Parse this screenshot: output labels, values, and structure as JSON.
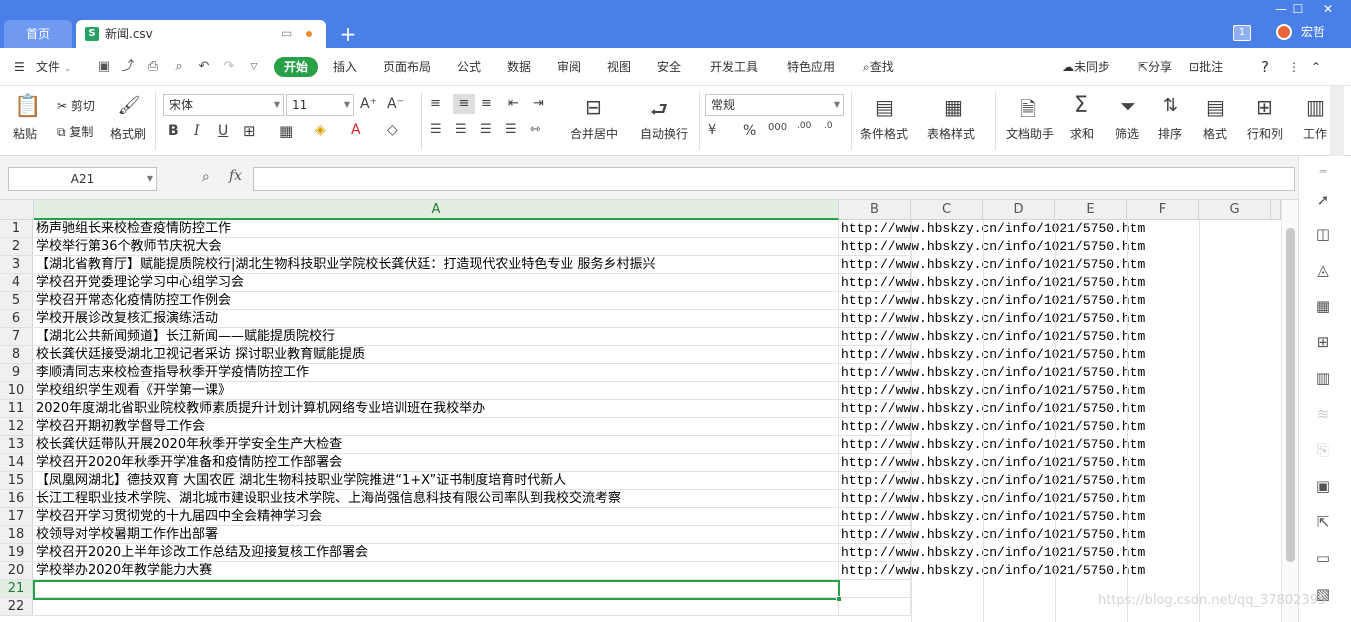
{
  "tabs": {
    "home": "首页",
    "file": "新闻.csv",
    "plus": "+"
  },
  "window": {
    "badge": "1",
    "user": "宏哲",
    "min": "—",
    "max": "☐",
    "close": "✕"
  },
  "menu": {
    "file": "文件",
    "start": "开始",
    "items": [
      "插入",
      "页面布局",
      "公式",
      "数据",
      "审阅",
      "视图",
      "安全",
      "开发工具",
      "特色应用"
    ],
    "search": "查找",
    "sync": "未同步",
    "share": "分享",
    "comment": "批注",
    "help": "?"
  },
  "ribbon": {
    "paste": "粘贴",
    "cut": "剪切",
    "copy": "复制",
    "format_painter": "格式刷",
    "font": "宋体",
    "size": "11",
    "merge": "合并居中",
    "wrap": "自动换行",
    "numfmt": "常规",
    "cond_format": "条件格式",
    "table_style": "表格样式",
    "doc_helper": "文档助手",
    "sum": "求和",
    "filter": "筛选",
    "sort": "排序",
    "format": "格式",
    "rowcol": "行和列",
    "worksheet": "工作"
  },
  "formula": {
    "namebox": "A21",
    "fx": "fx",
    "value": ""
  },
  "columns": [
    "A",
    "B",
    "C",
    "D",
    "E",
    "F",
    "G"
  ],
  "rows": [
    {
      "n": "1",
      "a": "杨声驰组长来校检查疫情防控工作",
      "b": "http://www.hbskzy.cn/info/1021/5750.htm"
    },
    {
      "n": "2",
      "a": "学校举行第36个教师节庆祝大会",
      "b": "http://www.hbskzy.cn/info/1021/5750.htm"
    },
    {
      "n": "3",
      "a": "【湖北省教育厅】赋能提质院校行|湖北生物科技职业学院校长龚伏廷：打造现代农业特色专业 服务乡村振兴",
      "b": "http://www.hbskzy.cn/info/1021/5750.htm"
    },
    {
      "n": "4",
      "a": "学校召开党委理论学习中心组学习会",
      "b": "http://www.hbskzy.cn/info/1021/5750.htm"
    },
    {
      "n": "5",
      "a": "学校召开常态化疫情防控工作例会",
      "b": "http://www.hbskzy.cn/info/1021/5750.htm"
    },
    {
      "n": "6",
      "a": "学校开展诊改复核汇报演练活动",
      "b": "http://www.hbskzy.cn/info/1021/5750.htm"
    },
    {
      "n": "7",
      "a": "【湖北公共新闻频道】长江新闻——赋能提质院校行",
      "b": "http://www.hbskzy.cn/info/1021/5750.htm"
    },
    {
      "n": "8",
      "a": "校长龚伏廷接受湖北卫视记者采访 探讨职业教育赋能提质",
      "b": "http://www.hbskzy.cn/info/1021/5750.htm"
    },
    {
      "n": "9",
      "a": "李顺清同志来校检查指导秋季开学疫情防控工作",
      "b": "http://www.hbskzy.cn/info/1021/5750.htm"
    },
    {
      "n": "10",
      "a": "学校组织学生观看《开学第一课》",
      "b": "http://www.hbskzy.cn/info/1021/5750.htm"
    },
    {
      "n": "11",
      "a": "2020年度湖北省职业院校教师素质提升计划计算机网络专业培训班在我校举办",
      "b": "http://www.hbskzy.cn/info/1021/5750.htm"
    },
    {
      "n": "12",
      "a": "学校召开期初教学督导工作会",
      "b": "http://www.hbskzy.cn/info/1021/5750.htm"
    },
    {
      "n": "13",
      "a": "校长龚伏廷带队开展2020年秋季开学安全生产大检查",
      "b": "http://www.hbskzy.cn/info/1021/5750.htm"
    },
    {
      "n": "14",
      "a": "学校召开2020年秋季开学准备和疫情防控工作部署会",
      "b": "http://www.hbskzy.cn/info/1021/5750.htm"
    },
    {
      "n": "15",
      "a": "【凤凰网湖北】德技双育 大国农匠 湖北生物科技职业学院推进“1+X”证书制度培育时代新人",
      "b": "http://www.hbskzy.cn/info/1021/5750.htm"
    },
    {
      "n": "16",
      "a": "长江工程职业技术学院、湖北城市建设职业技术学院、上海尚强信息科技有限公司率队到我校交流考察",
      "b": "http://www.hbskzy.cn/info/1021/5750.htm"
    },
    {
      "n": "17",
      "a": "学校召开学习贯彻党的十九届四中全会精神学习会",
      "b": "http://www.hbskzy.cn/info/1021/5750.htm"
    },
    {
      "n": "18",
      "a": "校领导对学校暑期工作作出部署",
      "b": "http://www.hbskzy.cn/info/1021/5750.htm"
    },
    {
      "n": "19",
      "a": "学校召开2020上半年诊改工作总结及迎接复核工作部署会",
      "b": "http://www.hbskzy.cn/info/1021/5750.htm"
    },
    {
      "n": "20",
      "a": "学校举办2020年教学能力大赛",
      "b": "http://www.hbskzy.cn/info/1021/5750.htm"
    },
    {
      "n": "21",
      "a": "",
      "b": ""
    },
    {
      "n": "22",
      "a": "",
      "b": ""
    }
  ],
  "watermark": "https://blog.csdn.net/qq_37802395"
}
